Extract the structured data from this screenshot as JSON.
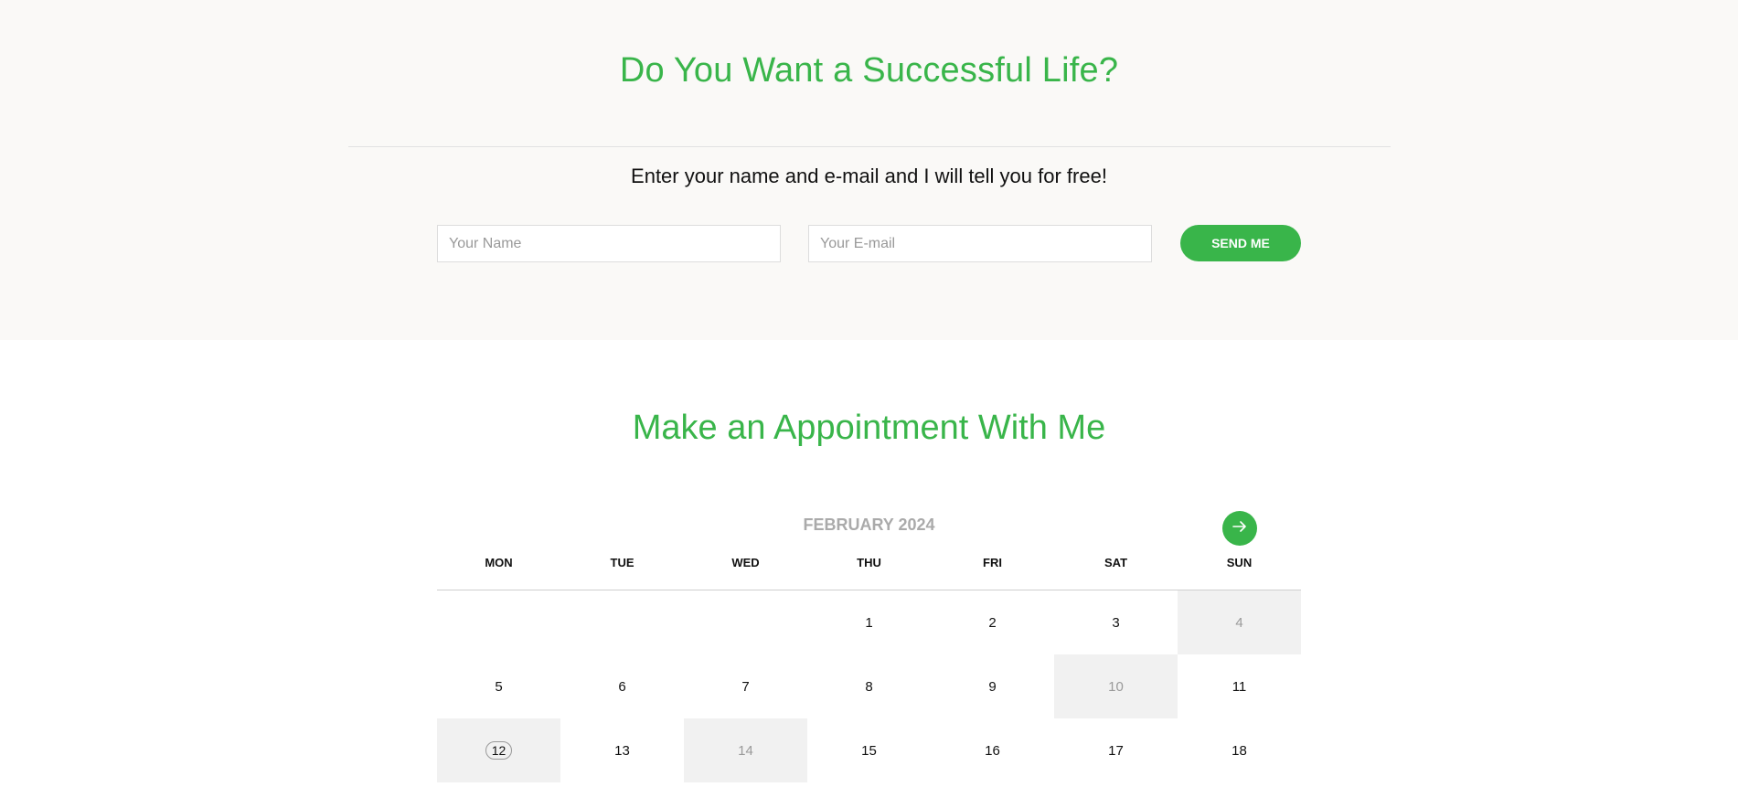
{
  "hero": {
    "title": "Do You Want a Successful Life?",
    "subtitle": "Enter your name and e-mail and I will tell you for free!",
    "name_placeholder": "Your Name",
    "email_placeholder": "Your E-mail",
    "send_label": "SEND ME"
  },
  "appointment": {
    "title": "Make an Appointment With Me",
    "month_label": "FEBRUARY 2024",
    "next_icon": "arrow-right-icon",
    "weekdays": [
      "MON",
      "TUE",
      "WED",
      "THU",
      "FRI",
      "SAT",
      "SUN"
    ],
    "weeks": [
      [
        "",
        "",
        "",
        "1",
        "2",
        "3",
        "4"
      ],
      [
        "5",
        "6",
        "7",
        "8",
        "9",
        "10",
        "11"
      ],
      [
        "12",
        "13",
        "14",
        "15",
        "16",
        "17",
        "18"
      ]
    ],
    "unavailable_days": [
      "4",
      "10",
      "14"
    ],
    "today": "12"
  },
  "colors": {
    "accent": "#39b54a",
    "section_bg": "#faf9f7",
    "muted_text": "#aaaaaa",
    "shaded_cell": "#f1f1f1"
  }
}
